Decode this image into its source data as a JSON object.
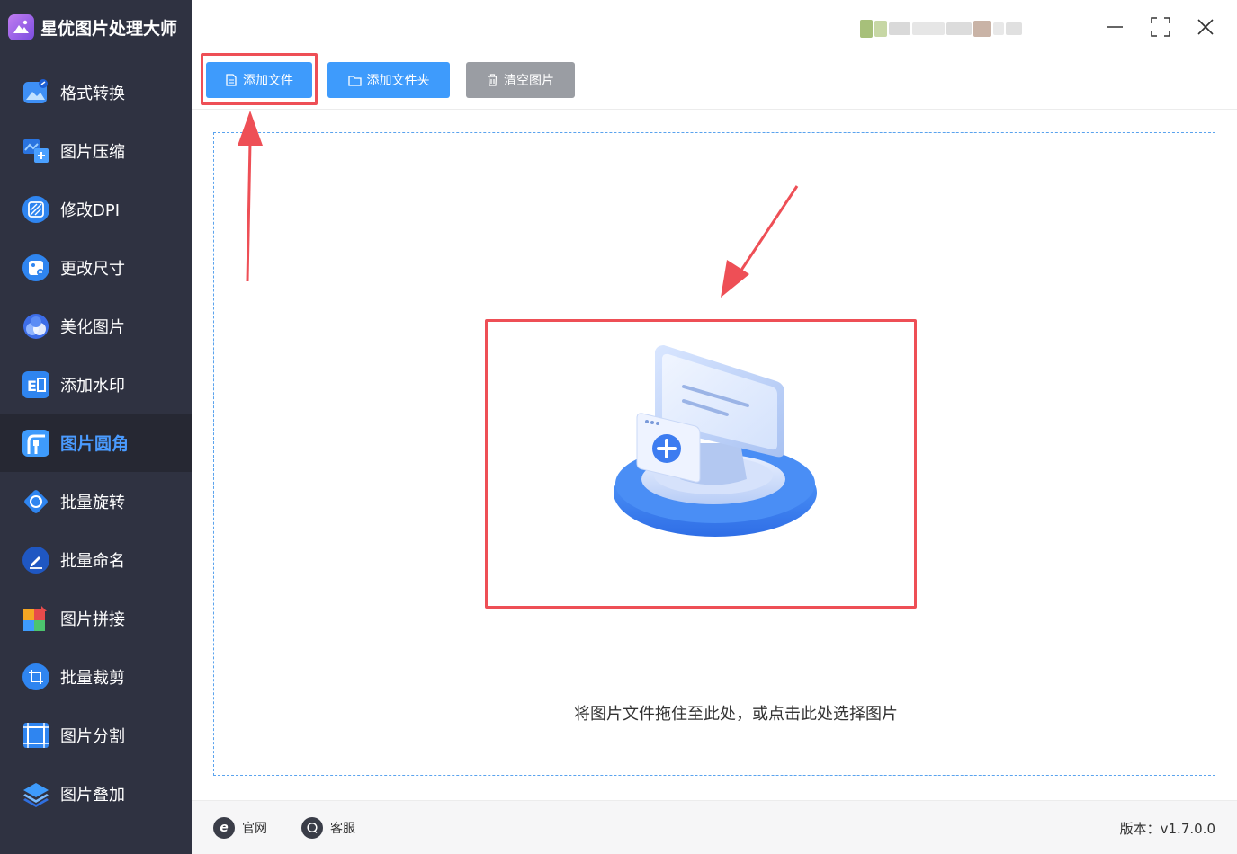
{
  "app": {
    "title": "星优图片处理大师"
  },
  "sidebar": {
    "items": [
      {
        "label": "格式转换",
        "icon": "image-convert-icon",
        "active": false
      },
      {
        "label": "图片压缩",
        "icon": "image-compress-icon",
        "active": false
      },
      {
        "label": "修改DPI",
        "icon": "dpi-icon",
        "active": false
      },
      {
        "label": "更改尺寸",
        "icon": "resize-icon",
        "active": false
      },
      {
        "label": "美化图片",
        "icon": "beautify-icon",
        "active": false
      },
      {
        "label": "添加水印",
        "icon": "watermark-icon",
        "active": false
      },
      {
        "label": "图片圆角",
        "icon": "round-corner-icon",
        "active": true
      },
      {
        "label": "批量旋转",
        "icon": "rotate-icon",
        "active": false
      },
      {
        "label": "批量命名",
        "icon": "rename-icon",
        "active": false
      },
      {
        "label": "图片拼接",
        "icon": "puzzle-icon",
        "active": false
      },
      {
        "label": "批量裁剪",
        "icon": "crop-icon",
        "active": false
      },
      {
        "label": "图片分割",
        "icon": "split-icon",
        "active": false
      },
      {
        "label": "图片叠加",
        "icon": "layers-icon",
        "active": false
      }
    ]
  },
  "toolbar": {
    "add_file": "添加文件",
    "add_folder": "添加文件夹",
    "clear_images": "清空图片"
  },
  "dropzone": {
    "hint": "将图片文件拖住至此处，或点击此处选择图片"
  },
  "footer": {
    "website": "官网",
    "support": "客服",
    "version": "版本：v1.7.0.0"
  },
  "colors": {
    "accent": "#3e9bfc",
    "sidebar": "#2f3241",
    "highlight": "#ee4f56"
  }
}
